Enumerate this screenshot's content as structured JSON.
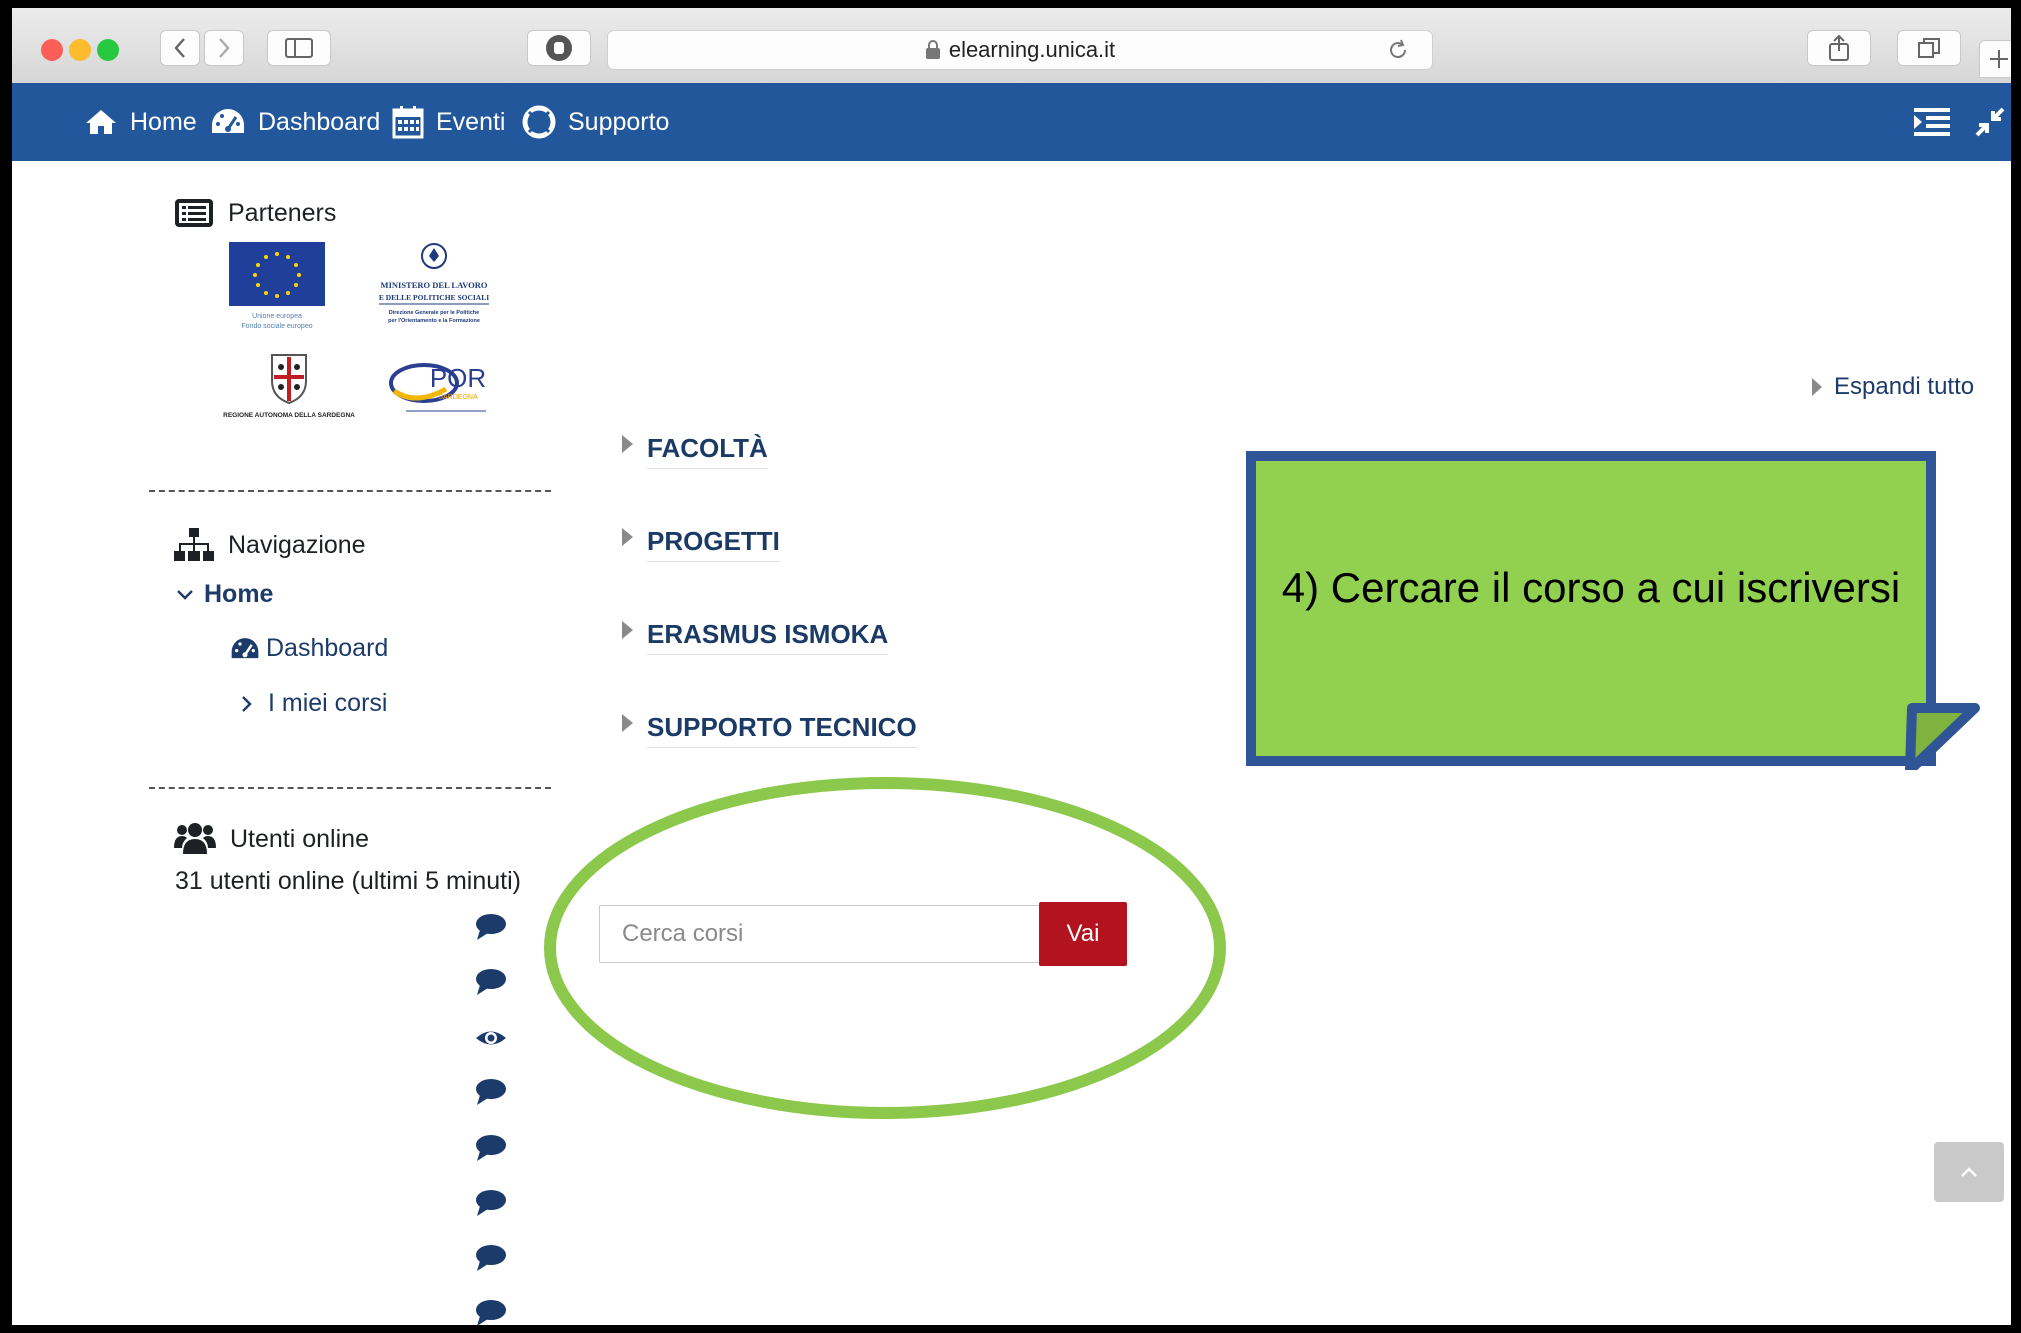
{
  "browser": {
    "url": "elearning.unica.it"
  },
  "navbar": {
    "items": [
      {
        "label": "Home",
        "icon": "home-icon"
      },
      {
        "label": "Dashboard",
        "icon": "dashboard-icon"
      },
      {
        "label": "Eventi",
        "icon": "calendar-icon"
      },
      {
        "label": "Supporto",
        "icon": "lifebuoy-icon"
      }
    ]
  },
  "sidebar": {
    "partners_title": "Parteners",
    "partner_logos": {
      "eu_caption_1": "Unione europea",
      "eu_caption_2": "Fondo sociale europeo",
      "ministero_1": "MINISTERO DEL LAVORO",
      "ministero_2": "E DELLE POLITICHE SOCIALI",
      "ministero_3": "Direzione Generale per le Politiche",
      "ministero_4": "per l'Orientamento e la Formazione",
      "regione": "REGIONE AUTONOMA DELLA SARDEGNA",
      "por": "POR",
      "por_sub": "SARDEGNA"
    },
    "navigation_title": "Navigazione",
    "home_label": "Home",
    "dashboard_label": "Dashboard",
    "my_courses_label": "I miei corsi",
    "online_title": "Utenti online",
    "online_summary": "31 utenti online (ultimi 5 minuti)"
  },
  "main": {
    "expand_all": "Espandi tutto",
    "categories": [
      "FACOLTÀ",
      "PROGETTI",
      "ERASMUS ISMOKA",
      "SUPPORTO TECNICO"
    ],
    "search_placeholder": "Cerca corsi",
    "search_button": "Vai"
  },
  "callout": {
    "text": "4) Cercare il corso a cui iscriversi",
    "fill_color": "#92d050",
    "border_color": "#2f5597"
  },
  "colors": {
    "navbar": "#23579b",
    "accent_button": "#b3121f",
    "highlight_ellipse": "#8cc84b"
  }
}
